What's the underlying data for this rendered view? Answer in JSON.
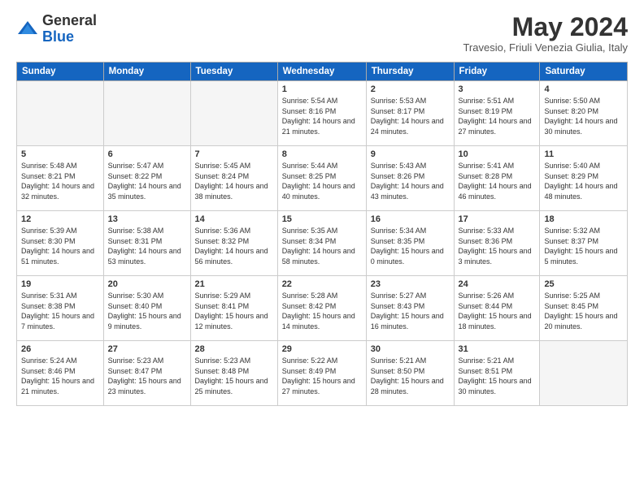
{
  "header": {
    "logo_general": "General",
    "logo_blue": "Blue",
    "month_title": "May 2024",
    "subtitle": "Travesio, Friuli Venezia Giulia, Italy"
  },
  "weekdays": [
    "Sunday",
    "Monday",
    "Tuesday",
    "Wednesday",
    "Thursday",
    "Friday",
    "Saturday"
  ],
  "weeks": [
    [
      {
        "day": "",
        "sunrise": "",
        "sunset": "",
        "daylight": "",
        "empty": true
      },
      {
        "day": "",
        "sunrise": "",
        "sunset": "",
        "daylight": "",
        "empty": true
      },
      {
        "day": "",
        "sunrise": "",
        "sunset": "",
        "daylight": "",
        "empty": true
      },
      {
        "day": "1",
        "sunrise": "Sunrise: 5:54 AM",
        "sunset": "Sunset: 8:16 PM",
        "daylight": "Daylight: 14 hours and 21 minutes.",
        "empty": false
      },
      {
        "day": "2",
        "sunrise": "Sunrise: 5:53 AM",
        "sunset": "Sunset: 8:17 PM",
        "daylight": "Daylight: 14 hours and 24 minutes.",
        "empty": false
      },
      {
        "day": "3",
        "sunrise": "Sunrise: 5:51 AM",
        "sunset": "Sunset: 8:19 PM",
        "daylight": "Daylight: 14 hours and 27 minutes.",
        "empty": false
      },
      {
        "day": "4",
        "sunrise": "Sunrise: 5:50 AM",
        "sunset": "Sunset: 8:20 PM",
        "daylight": "Daylight: 14 hours and 30 minutes.",
        "empty": false
      }
    ],
    [
      {
        "day": "5",
        "sunrise": "Sunrise: 5:48 AM",
        "sunset": "Sunset: 8:21 PM",
        "daylight": "Daylight: 14 hours and 32 minutes.",
        "empty": false
      },
      {
        "day": "6",
        "sunrise": "Sunrise: 5:47 AM",
        "sunset": "Sunset: 8:22 PM",
        "daylight": "Daylight: 14 hours and 35 minutes.",
        "empty": false
      },
      {
        "day": "7",
        "sunrise": "Sunrise: 5:45 AM",
        "sunset": "Sunset: 8:24 PM",
        "daylight": "Daylight: 14 hours and 38 minutes.",
        "empty": false
      },
      {
        "day": "8",
        "sunrise": "Sunrise: 5:44 AM",
        "sunset": "Sunset: 8:25 PM",
        "daylight": "Daylight: 14 hours and 40 minutes.",
        "empty": false
      },
      {
        "day": "9",
        "sunrise": "Sunrise: 5:43 AM",
        "sunset": "Sunset: 8:26 PM",
        "daylight": "Daylight: 14 hours and 43 minutes.",
        "empty": false
      },
      {
        "day": "10",
        "sunrise": "Sunrise: 5:41 AM",
        "sunset": "Sunset: 8:28 PM",
        "daylight": "Daylight: 14 hours and 46 minutes.",
        "empty": false
      },
      {
        "day": "11",
        "sunrise": "Sunrise: 5:40 AM",
        "sunset": "Sunset: 8:29 PM",
        "daylight": "Daylight: 14 hours and 48 minutes.",
        "empty": false
      }
    ],
    [
      {
        "day": "12",
        "sunrise": "Sunrise: 5:39 AM",
        "sunset": "Sunset: 8:30 PM",
        "daylight": "Daylight: 14 hours and 51 minutes.",
        "empty": false
      },
      {
        "day": "13",
        "sunrise": "Sunrise: 5:38 AM",
        "sunset": "Sunset: 8:31 PM",
        "daylight": "Daylight: 14 hours and 53 minutes.",
        "empty": false
      },
      {
        "day": "14",
        "sunrise": "Sunrise: 5:36 AM",
        "sunset": "Sunset: 8:32 PM",
        "daylight": "Daylight: 14 hours and 56 minutes.",
        "empty": false
      },
      {
        "day": "15",
        "sunrise": "Sunrise: 5:35 AM",
        "sunset": "Sunset: 8:34 PM",
        "daylight": "Daylight: 14 hours and 58 minutes.",
        "empty": false
      },
      {
        "day": "16",
        "sunrise": "Sunrise: 5:34 AM",
        "sunset": "Sunset: 8:35 PM",
        "daylight": "Daylight: 15 hours and 0 minutes.",
        "empty": false
      },
      {
        "day": "17",
        "sunrise": "Sunrise: 5:33 AM",
        "sunset": "Sunset: 8:36 PM",
        "daylight": "Daylight: 15 hours and 3 minutes.",
        "empty": false
      },
      {
        "day": "18",
        "sunrise": "Sunrise: 5:32 AM",
        "sunset": "Sunset: 8:37 PM",
        "daylight": "Daylight: 15 hours and 5 minutes.",
        "empty": false
      }
    ],
    [
      {
        "day": "19",
        "sunrise": "Sunrise: 5:31 AM",
        "sunset": "Sunset: 8:38 PM",
        "daylight": "Daylight: 15 hours and 7 minutes.",
        "empty": false
      },
      {
        "day": "20",
        "sunrise": "Sunrise: 5:30 AM",
        "sunset": "Sunset: 8:40 PM",
        "daylight": "Daylight: 15 hours and 9 minutes.",
        "empty": false
      },
      {
        "day": "21",
        "sunrise": "Sunrise: 5:29 AM",
        "sunset": "Sunset: 8:41 PM",
        "daylight": "Daylight: 15 hours and 12 minutes.",
        "empty": false
      },
      {
        "day": "22",
        "sunrise": "Sunrise: 5:28 AM",
        "sunset": "Sunset: 8:42 PM",
        "daylight": "Daylight: 15 hours and 14 minutes.",
        "empty": false
      },
      {
        "day": "23",
        "sunrise": "Sunrise: 5:27 AM",
        "sunset": "Sunset: 8:43 PM",
        "daylight": "Daylight: 15 hours and 16 minutes.",
        "empty": false
      },
      {
        "day": "24",
        "sunrise": "Sunrise: 5:26 AM",
        "sunset": "Sunset: 8:44 PM",
        "daylight": "Daylight: 15 hours and 18 minutes.",
        "empty": false
      },
      {
        "day": "25",
        "sunrise": "Sunrise: 5:25 AM",
        "sunset": "Sunset: 8:45 PM",
        "daylight": "Daylight: 15 hours and 20 minutes.",
        "empty": false
      }
    ],
    [
      {
        "day": "26",
        "sunrise": "Sunrise: 5:24 AM",
        "sunset": "Sunset: 8:46 PM",
        "daylight": "Daylight: 15 hours and 21 minutes.",
        "empty": false
      },
      {
        "day": "27",
        "sunrise": "Sunrise: 5:23 AM",
        "sunset": "Sunset: 8:47 PM",
        "daylight": "Daylight: 15 hours and 23 minutes.",
        "empty": false
      },
      {
        "day": "28",
        "sunrise": "Sunrise: 5:23 AM",
        "sunset": "Sunset: 8:48 PM",
        "daylight": "Daylight: 15 hours and 25 minutes.",
        "empty": false
      },
      {
        "day": "29",
        "sunrise": "Sunrise: 5:22 AM",
        "sunset": "Sunset: 8:49 PM",
        "daylight": "Daylight: 15 hours and 27 minutes.",
        "empty": false
      },
      {
        "day": "30",
        "sunrise": "Sunrise: 5:21 AM",
        "sunset": "Sunset: 8:50 PM",
        "daylight": "Daylight: 15 hours and 28 minutes.",
        "empty": false
      },
      {
        "day": "31",
        "sunrise": "Sunrise: 5:21 AM",
        "sunset": "Sunset: 8:51 PM",
        "daylight": "Daylight: 15 hours and 30 minutes.",
        "empty": false
      },
      {
        "day": "",
        "sunrise": "",
        "sunset": "",
        "daylight": "",
        "empty": true
      }
    ]
  ]
}
